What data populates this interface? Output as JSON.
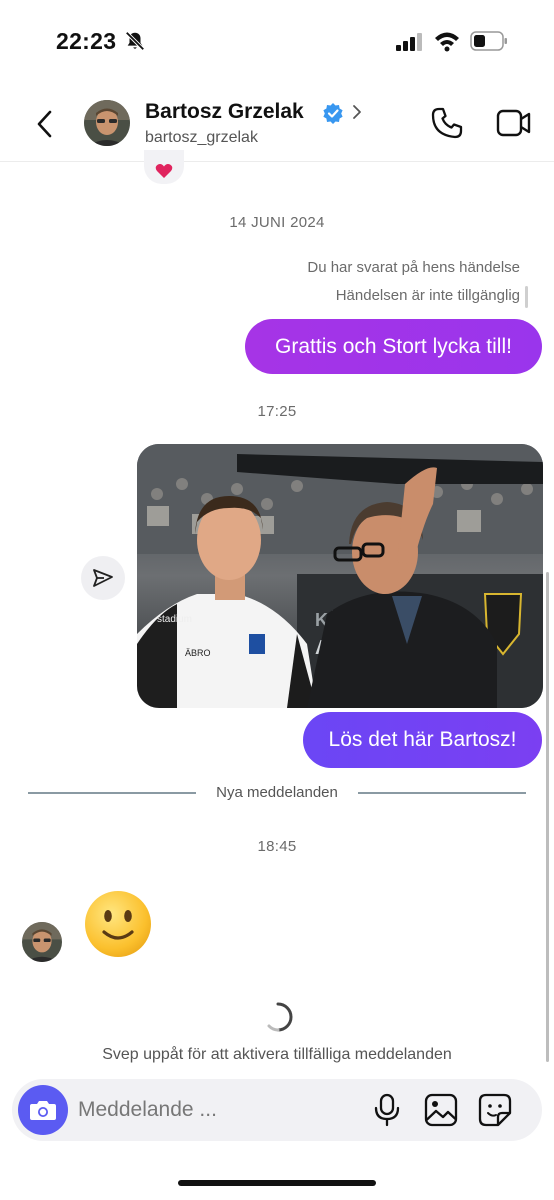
{
  "status_bar": {
    "time": "22:23",
    "icons": [
      "bell-muted-icon",
      "cellular-signal-icon",
      "wifi-icon",
      "battery-icon"
    ]
  },
  "header": {
    "name": "Bartosz Grzelak",
    "handle": "bartosz_grzelak",
    "verified": true,
    "icons": [
      "back-icon",
      "verified-badge-icon",
      "chevron-right-icon",
      "phone-icon",
      "video-icon"
    ],
    "accent": "#3897f0"
  },
  "conversation": {
    "date_separator": "14 JUNI 2024",
    "system_lines": [
      "Du har svarat på hens händelse",
      "Händelsen är inte tillgänglig"
    ],
    "outgoing_1": "Grattis och Stort lycka till!",
    "time_1": "17:25",
    "outgoing_2": "Lös det här Bartosz!",
    "new_messages_label": "Nya meddelanden",
    "time_2": "18:45",
    "incoming_emoji": "slightly-smiling-face"
  },
  "footer": {
    "swipe_hint": "Svep uppåt för att aktivera tillfälliga meddelanden",
    "placeholder": "Meddelande ...",
    "icons": [
      "camera-icon",
      "microphone-icon",
      "gallery-icon",
      "sticker-icon"
    ]
  },
  "colors": {
    "bubble_1": "#a634e6",
    "bubble_2": "#6b46f5",
    "camera_button": "#5b5bf2"
  }
}
